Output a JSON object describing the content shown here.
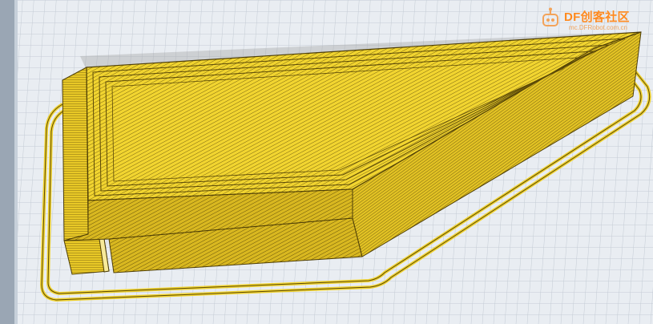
{
  "scene": {
    "description_colors": {
      "background": "#e9edf2",
      "grid_minor": "#c4cbd4",
      "grid_major": "#a9b2bd",
      "filament": "#f0d22e",
      "filament_shadow": "#caa81a",
      "filament_line": "#5c4a08"
    },
    "object": "sliced-print-preview",
    "skirt": "brim-outline"
  },
  "watermark": {
    "brand": "DF创客社区",
    "site": "mc.DFRobot.com.cn",
    "icon": "robot-logo-icon"
  }
}
